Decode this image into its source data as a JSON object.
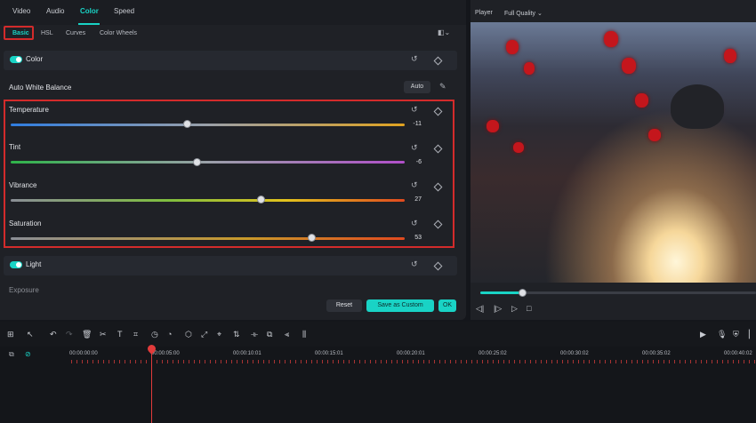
{
  "tabs": [
    "Video",
    "Audio",
    "Color",
    "Speed"
  ],
  "subtabs": [
    "Basic",
    "HSL",
    "Curves",
    "Color Wheels"
  ],
  "sections": {
    "color": "Color",
    "auto_white_balance": "Auto White Balance",
    "auto_button": "Auto",
    "light": "Light",
    "exposure": "Exposure"
  },
  "sliders": [
    {
      "label": "Temperature",
      "value": "-11",
      "level": 0.44
    },
    {
      "label": "Tint",
      "value": "-6",
      "level": 0.47
    },
    {
      "label": "Vibrance",
      "value": "27",
      "level": 0.63
    },
    {
      "label": "Saturation",
      "value": "53",
      "level": 0.76
    }
  ],
  "buttons": {
    "reset": "Reset",
    "save_custom": "Save as Custom",
    "ok": "OK"
  },
  "player": {
    "label": "Player",
    "quality": "Full Quality",
    "progress": 0.18
  },
  "timeline": {
    "timecodes": [
      "00:00:00:00",
      "00:00:05:00",
      "00:00:10:01",
      "00:00:15:01",
      "00:00:20:01",
      "00:00:25:02",
      "00:00:30:02",
      "00:00:35:02",
      "00:00:40:02"
    ]
  },
  "colors": {
    "accent": "#19d3c5",
    "highlight": "#d32b2b"
  },
  "icons": [
    "undo-icon",
    "redo-icon",
    "delete-icon",
    "cut-icon",
    "text-icon",
    "crop-icon",
    "timer-icon",
    "color-icon",
    "play-icon",
    "mic-icon",
    "shield-icon",
    "zoom-icon"
  ]
}
